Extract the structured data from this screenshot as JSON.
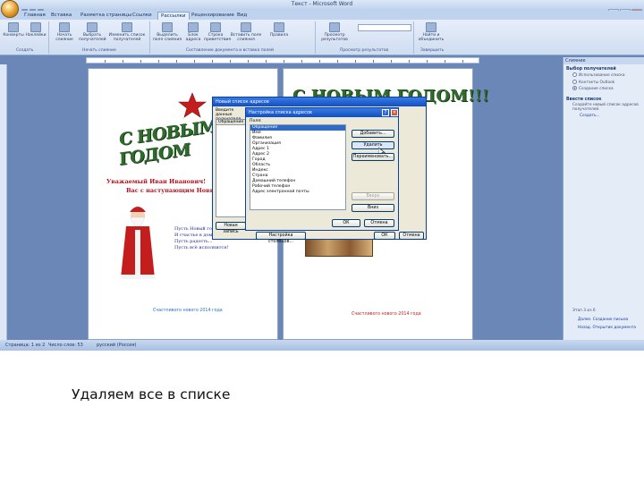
{
  "window": {
    "title": "Текст - Microsoft Word",
    "controls": [
      "–",
      "□",
      "✕"
    ]
  },
  "ribbon": {
    "tabs": [
      "Главная",
      "Вставка",
      "Разметка страницы",
      "Ссылки",
      "Рассылки",
      "Рецензирование",
      "Вид"
    ],
    "active_tab": "Рассылки",
    "buttons": [
      "Конверты",
      "Наклейки",
      "Начать слияние",
      "Выбрать получателей",
      "Изменить список получателей",
      "Выделить поля слияния",
      "Блок адреса",
      "Строка приветствия",
      "Вставить поле слияния",
      "Правила",
      "Просмотр результатов",
      "Найти и объединить"
    ],
    "groups": [
      "Создать",
      "Начать слияние",
      "Составление документа и вставка полей",
      "Просмотр результатов",
      "Завершить"
    ]
  },
  "status": {
    "page": "Страница: 1 из 2",
    "words": "Число слов: 53",
    "language": "русский (Россия)"
  },
  "document": {
    "left_page": {
      "greeting_title": "С НОВЫМ ГОДОМ",
      "line1": "Уважаемый Иван Иванович!",
      "line2": "Вас с наступающим Новым",
      "poem": [
        "Пусть Новый год...",
        "И счастье в доме...",
        "Пусть радость...",
        "Пусть всё исполнится!"
      ],
      "footer": "Счастливого нового 2014 года"
    },
    "right_page": {
      "greeting_title": "С НОВЫМ ГОДОМ!!!",
      "footer": "Счастливого нового 2014 года"
    }
  },
  "dialog_back": {
    "title": "Новый список адресов",
    "header_text": "Введите данные получателя...",
    "column": "Обращение",
    "new_entry_button": "Новая запись",
    "columns_button": "Настройка столбцов...",
    "ok_button": "ОК",
    "cancel_button": "Отмена"
  },
  "dialog_front": {
    "title": "Настройка списка адресов",
    "fields_label": "Поля:",
    "fields": [
      "Обращение",
      "Имя",
      "Фамилия",
      "Организация",
      "Адрес 1",
      "Адрес 2",
      "Город",
      "Область",
      "Индекс",
      "Страна",
      "Домашний телефон",
      "Рабочий телефон",
      "Адрес электронной почты"
    ],
    "selected_field": "Обращение",
    "add_button": "Добавить...",
    "delete_button": "Удалить",
    "rename_button": "Переименовать...",
    "up_button": "Вверх",
    "down_button": "Вниз",
    "ok_button": "ОК",
    "cancel_button": "Отмена"
  },
  "task_pane": {
    "title": "Слияние",
    "section1": "Выбор получателей",
    "options": [
      "Использование списка",
      "Контакты Outlook",
      "Создание списка"
    ],
    "section2": "Ввести список",
    "desc": "Создайте новый список адресов получателей.",
    "create_link": "Создать...",
    "step": "Этап 3 из 6",
    "next_link": "Далее. Создание письма",
    "prev_link": "Назад. Открытие документа"
  },
  "slide_caption": "Удаляем все в списке",
  "colors": {
    "accent_red": "#c51b1b",
    "ribbon_blue": "#cfddf1",
    "dialog_title_blue": "#0f4fc6"
  }
}
